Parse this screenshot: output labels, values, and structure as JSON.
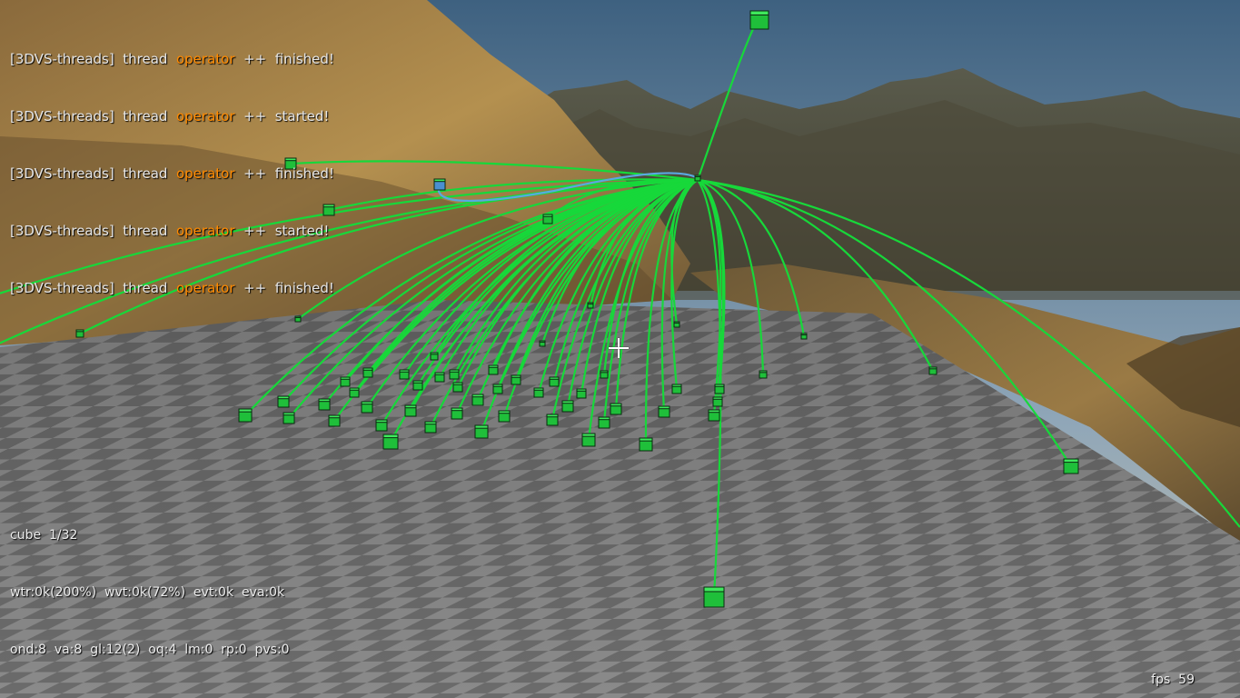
{
  "log": {
    "lines": [
      {
        "prefix": "[3DVS-threads]",
        "word": "thread",
        "keyword": "operator",
        "op": "++",
        "status": "finished!"
      },
      {
        "prefix": "[3DVS-threads]",
        "word": "thread",
        "keyword": "operator",
        "op": "++",
        "status": "started!"
      },
      {
        "prefix": "[3DVS-threads]",
        "word": "thread",
        "keyword": "operator",
        "op": "++",
        "status": "finished!"
      },
      {
        "prefix": "[3DVS-threads]",
        "word": "thread",
        "keyword": "operator",
        "op": "++",
        "status": "started!"
      },
      {
        "prefix": "[3DVS-threads]",
        "word": "thread",
        "keyword": "operator",
        "op": "++",
        "status": "finished!"
      }
    ]
  },
  "hud": {
    "cube_label": "cube",
    "cube_index": "1/32",
    "stats_line1": "wtr:0k(200%)  wvt:0k(72%)  evt:0k  eva:0k",
    "stats_line2": "ond:8  va:8  gl:12(2)  oq:4  lm:0  rp:0  pvs:0",
    "fps_label": "fps",
    "fps_value": "59"
  },
  "colors": {
    "link_green": "#17d83a",
    "link_blue": "#5aa8e0",
    "cube_green": "#1fbf3a",
    "cube_blue": "#4a8fd0",
    "log_keyword": "#ff8a00"
  }
}
